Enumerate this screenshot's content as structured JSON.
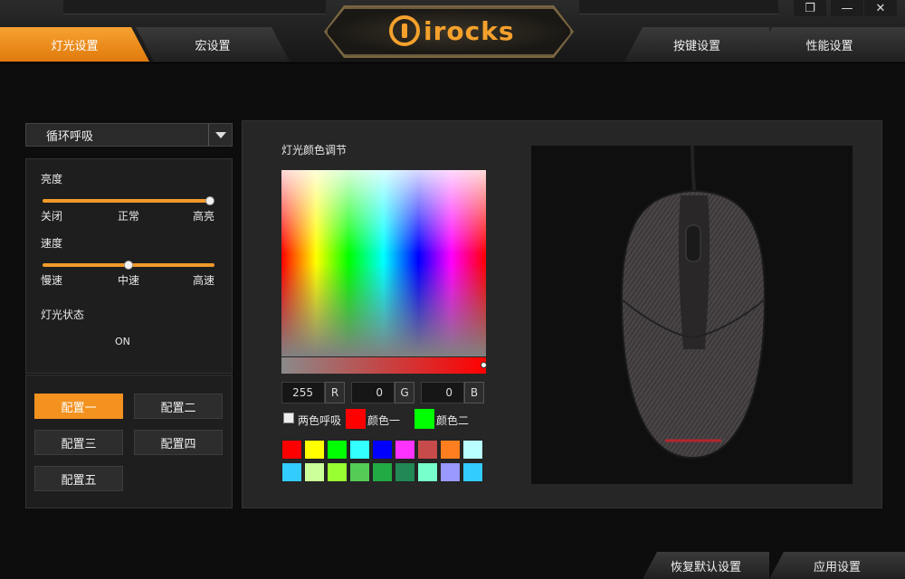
{
  "window": {
    "logo_text": "irocks",
    "controls": {
      "restore": "❐",
      "minimize": "—",
      "close": "✕"
    }
  },
  "tabs": {
    "lighting": "灯光设置",
    "macro": "宏设置",
    "keys": "按键设置",
    "performance": "性能设置"
  },
  "lighting": {
    "mode_value": "循环呼吸",
    "brightness": {
      "label": "亮度",
      "min": "关闭",
      "mid": "正常",
      "max": "高亮",
      "level": 1.0
    },
    "speed": {
      "label": "速度",
      "min": "慢速",
      "mid": "中速",
      "max": "高速",
      "level": 0.5
    },
    "status": {
      "label": "灯光状态",
      "value": "ON"
    }
  },
  "profiles": [
    "配置一",
    "配置二",
    "配置三",
    "配置四",
    "配置五"
  ],
  "color": {
    "title": "灯光颜色调节",
    "r": "255",
    "g": "0",
    "b": "0",
    "r_label": "R",
    "g_label": "G",
    "b_label": "B",
    "dual_breath_label": "两色呼吸",
    "color1_label": "颜色一",
    "color2_label": "颜色二",
    "color1": "#ff0000",
    "color2": "#00ff00",
    "swatches_row1": [
      "#ff0000",
      "#ffff00",
      "#00ff00",
      "#33ffff",
      "#0000ff",
      "#ff33ff",
      "#c84b4b",
      "#ff7f20",
      "#b9ffff"
    ],
    "swatches_row2": [
      "#33ccff",
      "#ccff99",
      "#99ff33",
      "#55cc55",
      "#22aa44",
      "#228855",
      "#77ffcc",
      "#9999ff",
      "#33ccff"
    ]
  },
  "footer": {
    "reset": "恢复默认设置",
    "apply": "应用设置"
  }
}
